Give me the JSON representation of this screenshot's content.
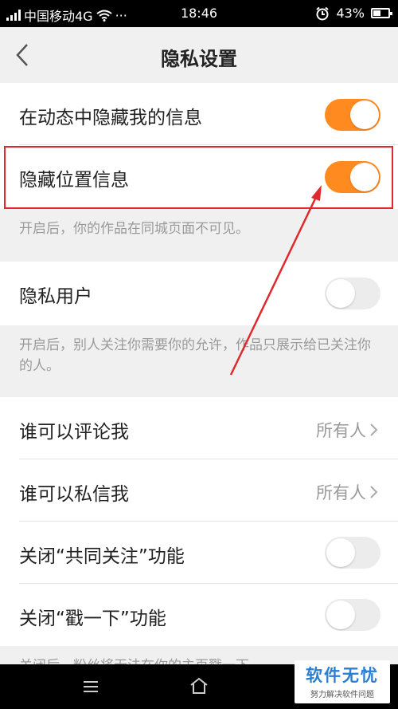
{
  "status_bar": {
    "carrier": "中国移动4G",
    "more": "···",
    "time": "18:46",
    "battery": "43%"
  },
  "header": {
    "title": "隐私设置"
  },
  "settings": {
    "hide_info_in_feed": {
      "label": "在动态中隐藏我的信息",
      "enabled": true
    },
    "hide_location": {
      "label": "隐藏位置信息",
      "enabled": true
    },
    "hide_location_note": "开启后，你的作品在同城页面不可见。",
    "private_user": {
      "label": "隐私用户",
      "enabled": false
    },
    "private_user_note": "开启后，别人关注你需要你的允许，作品只展示给已关注你的人。",
    "who_can_comment": {
      "label": "谁可以评论我",
      "value": "所有人"
    },
    "who_can_message": {
      "label": "谁可以私信我",
      "value": "所有人"
    },
    "close_mutual_follow": {
      "label": "关闭“共同关注”功能",
      "enabled": false
    },
    "close_poke": {
      "label": "关闭“戳一下”功能",
      "enabled": false
    },
    "poke_note_partial": "关闭后，粉丝将无法在你的主页戳一下"
  },
  "watermark": {
    "title": "软件无忧",
    "subtitle": "努力解决软件问题"
  },
  "colors": {
    "accent": "#ff8a1f",
    "highlight_box": "#e0292d",
    "arrow": "#e0292d"
  }
}
